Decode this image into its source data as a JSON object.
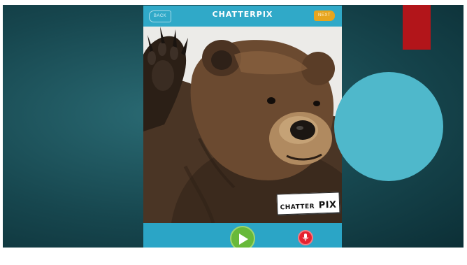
{
  "app": {
    "title": "CHATTERPIX",
    "back_label": "BACK",
    "next_label": "NEXT"
  },
  "photo": {
    "subject": "bear",
    "logo_word1": "CHATTER",
    "logo_word2": "PIX"
  },
  "controls": {
    "play_icon": "play-icon",
    "record_icon": "microphone-icon"
  },
  "colors": {
    "slide_background": "#17474f",
    "accent_red": "#b2151a",
    "accent_circle": "#4fb8cb",
    "app_bar": "#30a9c8",
    "next_button": "#e7a51e",
    "play_button": "#68b93a",
    "record_button": "#e62230"
  }
}
